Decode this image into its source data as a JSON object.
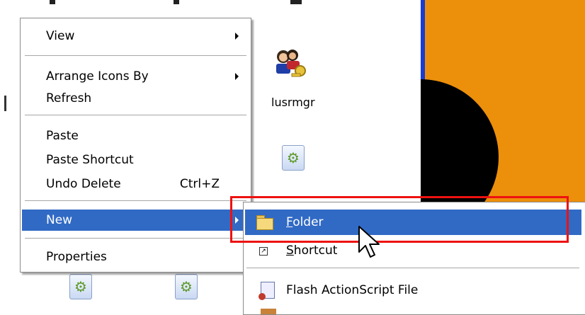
{
  "context_menu": {
    "items": [
      {
        "label": "View",
        "has_submenu": true
      },
      {
        "label": "Arrange Icons By",
        "has_submenu": true
      },
      {
        "label": "Refresh"
      },
      {
        "label": "Paste"
      },
      {
        "label": "Paste Shortcut"
      },
      {
        "label": "Undo Delete",
        "shortcut": "Ctrl+Z"
      },
      {
        "label": "New",
        "has_submenu": true,
        "state": "highlighted"
      },
      {
        "label": "Properties"
      }
    ]
  },
  "new_submenu": {
    "items": [
      {
        "label_first": "F",
        "label_rest": "older",
        "icon": "folder-icon",
        "state": "highlighted"
      },
      {
        "label_first": "S",
        "label_rest": "hortcut",
        "icon": "shortcut-icon"
      },
      {
        "label": "Flash ActionScript File",
        "icon": "flash-actionscript-file-icon"
      }
    ]
  },
  "desktop_icons": [
    {
      "label": "lusrmgr",
      "icon": "users-key-icon"
    },
    {
      "label": "",
      "icon": "setup-icon"
    }
  ],
  "colors": {
    "menu_highlight": "#316ac5",
    "annotation": "#ee1111",
    "wallpaper": "#ec8f0a"
  }
}
